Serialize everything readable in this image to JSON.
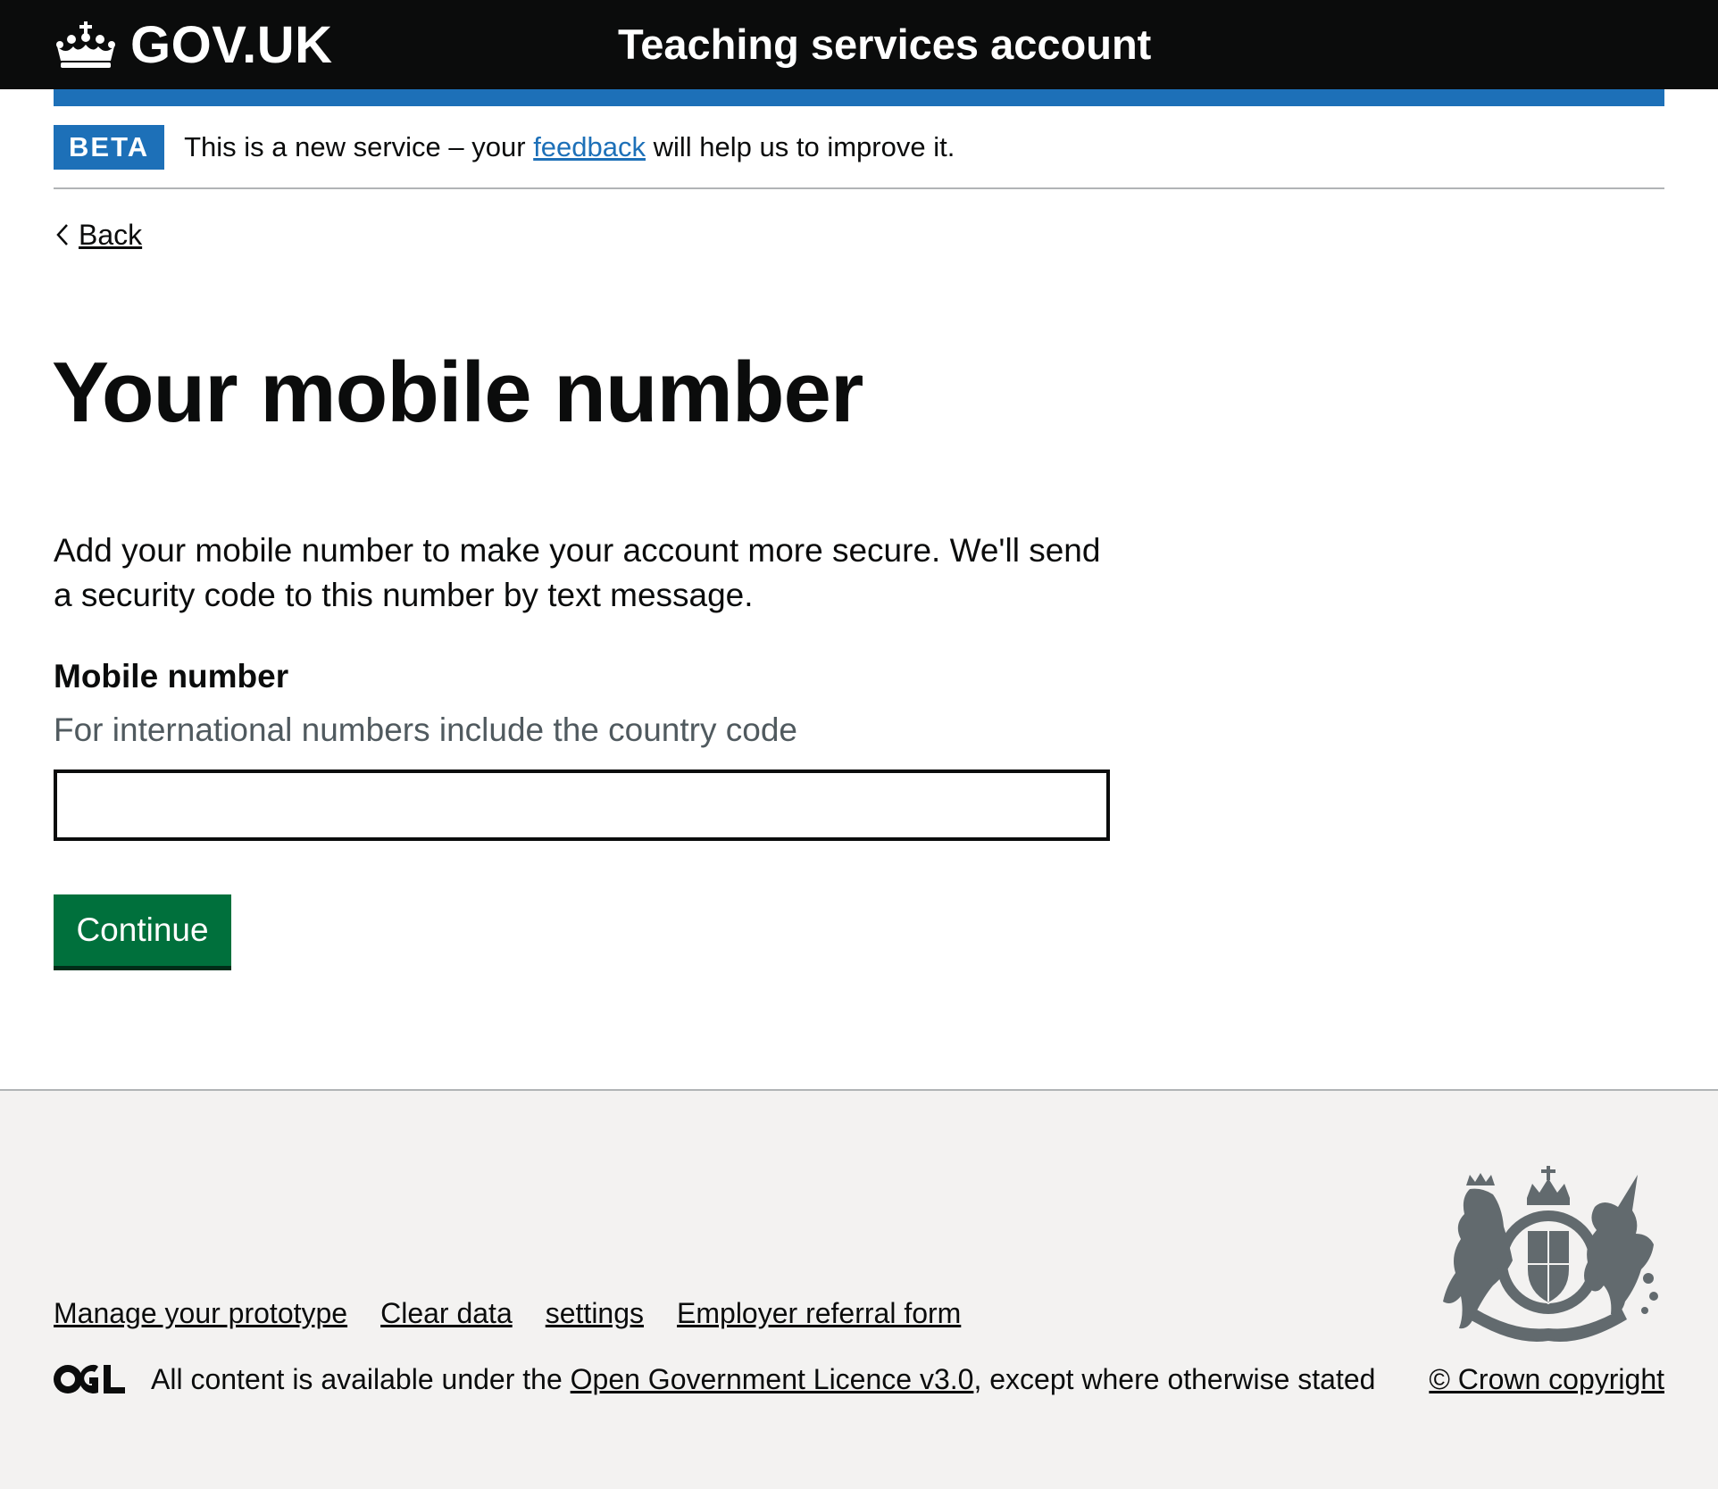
{
  "header": {
    "logo_text": "GOV.UK",
    "service_name": "Teaching services account"
  },
  "phase_banner": {
    "tag": "BETA",
    "text_before": "This is a new service – your ",
    "link": "feedback",
    "text_after": " will help us to improve it."
  },
  "back_link": "Back",
  "main": {
    "title": "Your mobile number",
    "body": "Add your mobile number to make your account more secure. We'll send a security code to this number by text message.",
    "field_label": "Mobile number",
    "hint": "For international numbers include the country code",
    "input_value": "",
    "button_label": "Continue"
  },
  "footer": {
    "links": [
      "Manage your prototype",
      "Clear data",
      "settings",
      "Employer referral form"
    ],
    "licence_before": "All content is available under the ",
    "licence_link": "Open Government Licence v3.0",
    "licence_after": ", except where otherwise stated",
    "copyright": "© Crown copyright"
  },
  "icons": {
    "logo": "crown-icon",
    "back": "chevron-left-icon",
    "licence": "ogl-logo",
    "crest": "royal-coat-of-arms"
  },
  "colors": {
    "header_bg": "#0b0c0c",
    "brand_blue": "#1d70b8",
    "button_green": "#00703c",
    "footer_bg": "#f3f2f1",
    "hint_grey": "#505a5f"
  }
}
